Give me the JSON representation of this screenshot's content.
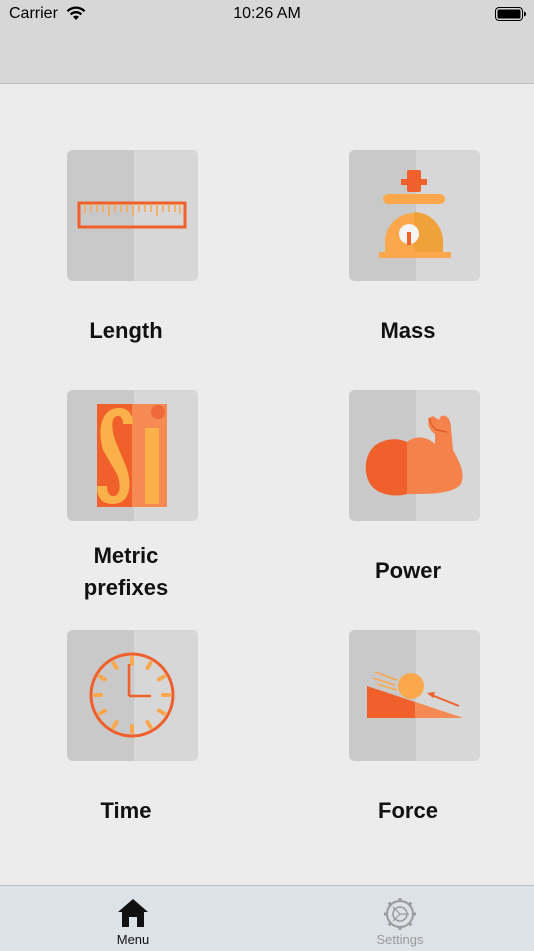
{
  "status_bar": {
    "carrier": "Carrier",
    "time": "10:26 AM"
  },
  "menu": {
    "items": [
      {
        "label": "Length",
        "icon": "ruler-icon"
      },
      {
        "label": "Mass",
        "icon": "scale-icon"
      },
      {
        "label": "Metric\nprefixes",
        "icon": "si-icon"
      },
      {
        "label": "Power",
        "icon": "flexed-arm-icon"
      },
      {
        "label": "Time",
        "icon": "clock-icon"
      },
      {
        "label": "Force",
        "icon": "ball-on-ramp-icon"
      }
    ]
  },
  "tab_bar": {
    "tabs": [
      {
        "label": "Menu",
        "icon": "home-icon",
        "active": true
      },
      {
        "label": "Settings",
        "icon": "gear-icon",
        "active": false
      }
    ]
  },
  "colors": {
    "accent_orange": "#f0602a",
    "light_orange": "#fba74b",
    "tab_active": "#111111",
    "tab_inactive": "#9a9a9a"
  }
}
